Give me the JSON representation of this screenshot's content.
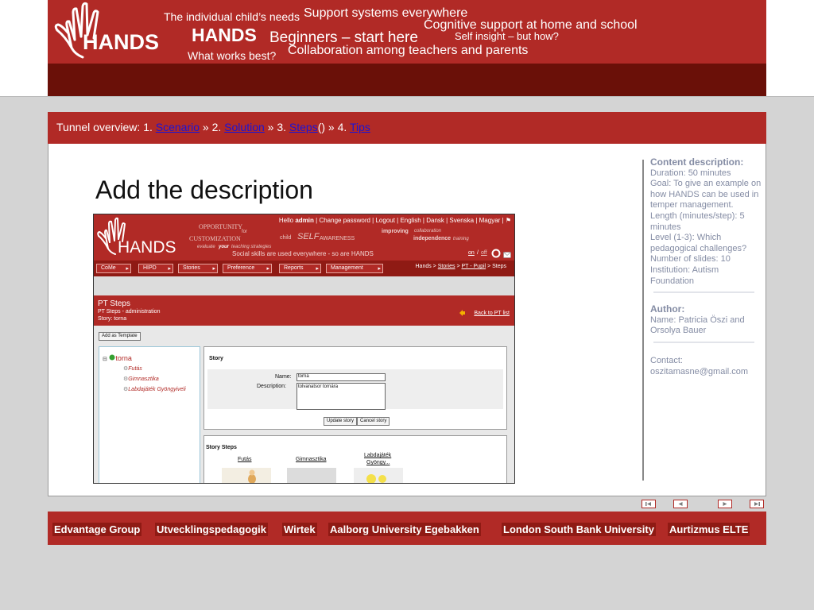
{
  "header": {
    "logo_text": "HANDS",
    "phrases": {
      "individual_needs": "The individual child’s needs",
      "support_systems": "Support systems everywhere",
      "cognitive_support": "Cognitive support at home and school",
      "hands": "HANDS",
      "beginners": "Beginners – start here",
      "self_insight": "Self insight – but how?",
      "what_works": "What works best?",
      "collaboration": "Collaboration among teachers and parents"
    }
  },
  "tunnel": {
    "prefix": "Tunnel overview:  1.",
    "steps": [
      {
        "label": "Scenario"
      },
      {
        "label": "Solution"
      },
      {
        "label": "Steps"
      },
      {
        "label": "Tips"
      }
    ],
    "sep1": "  »  2.",
    "sep2": "  »  3.",
    "after_steps": "()",
    "sep3": "  »  4."
  },
  "main": {
    "title": "Add the description"
  },
  "embedded": {
    "topnav": {
      "hello": "Hello",
      "user": "admin",
      "links": "| Change password  | Logout | English | Dansk | Svenska | Magyar | ⚑"
    },
    "banner": {
      "logo_text": "HANDS",
      "opportunity": "OPPORTUNITY",
      "for": "for",
      "customization": "CUSTOMIZATION",
      "child": "child",
      "self": "SELF",
      "awareness": "AWARENESS",
      "improving": "improving",
      "collaboration": "collaboration",
      "independence": "independence",
      "training": "training",
      "evaluate": "evaluate",
      "your": "your",
      "teaching_strategies": "teaching strategies",
      "tagline": "Social  skills  are  used  everywhere  -  so  are  HANDS",
      "on": "on",
      "off": "off"
    },
    "menu": [
      "CoMe",
      "HIPD",
      "Stories",
      "Preference",
      "Reports",
      "Management"
    ],
    "breadcrumb": {
      "root": "Hands",
      "stories": "Stories",
      "pt_pupil": "PT - Pupil",
      "current": "Steps"
    },
    "page": {
      "title": "PT Steps",
      "sub1": "PT Steps - administration",
      "sub2": "Story: torna",
      "back": "Back to PT list"
    },
    "add_template_label": "Add as Template",
    "tree": {
      "root": "torna",
      "children": [
        "Futás",
        "Gimnasztika",
        "Labdajáték Gyöngyiveli"
      ]
    },
    "story_panel": {
      "heading": "Story",
      "name_label": "Name:",
      "name_value": "torna",
      "desc_label": "Description:",
      "desc_value": "tolvanatsor tornára",
      "update_label": "Update story",
      "cancel_label": "Cancel story"
    },
    "steps_panel": {
      "heading": "Story Steps",
      "steps": [
        "Futás",
        "Gimnasztika",
        "Labdajáték",
        "Gyöngy..."
      ]
    }
  },
  "info": {
    "content_label": "Content  description:",
    "duration": "Duration: 50 minutes",
    "goal": "Goal: To give an example on how HANDS can  be used in temper management.",
    "length": "Length (minutes/step): 5 minutes",
    "level": "Level (1-3): Which pedagogical  challenges?",
    "slides": "Number of slides: 10",
    "institution": "Institution: Autism Foundation",
    "author_label": "Author:",
    "author_name": "Name: Patricia Öszi  and Orsolya  Bauer",
    "contact_label": "Contact:",
    "contact_email": "oszitamasne@gmail.com"
  },
  "footer": {
    "partners": [
      "Edvantage Group",
      "Utvecklingspedagogik",
      "Wirtek",
      "Aalborg University Egebakken",
      "London South Bank University",
      "Aurtizmus ELTE"
    ]
  },
  "colors": {
    "brand_red": "#b12a26",
    "dark_red": "#6a1008",
    "link_blue": "#1a14d6",
    "info_gray": "#848ca4"
  }
}
